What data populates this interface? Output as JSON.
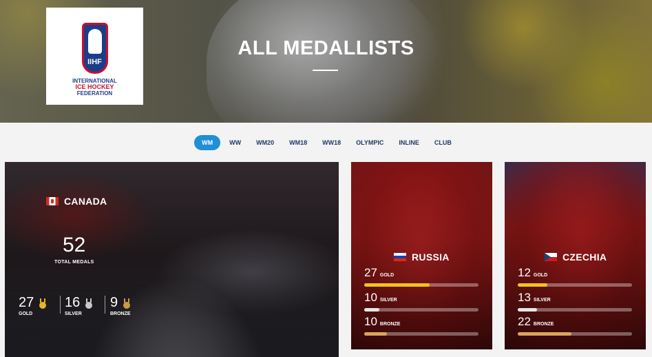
{
  "header": {
    "title": "ALL MEDALLISTS",
    "logo": {
      "abbr": "IIHF",
      "line1": "INTERNATIONAL",
      "line2": "ICE HOCKEY",
      "line3": "FEDERATION"
    }
  },
  "tabs": [
    {
      "label": "WM",
      "active": true
    },
    {
      "label": "WW",
      "active": false
    },
    {
      "label": "WM20",
      "active": false
    },
    {
      "label": "WM18",
      "active": false
    },
    {
      "label": "WW18",
      "active": false
    },
    {
      "label": "OLYMPIC",
      "active": false
    },
    {
      "label": "INLINE",
      "active": false
    },
    {
      "label": "CLUB",
      "active": false
    }
  ],
  "featured": {
    "country": "CANADA",
    "total": "52",
    "total_label": "TOTAL MEDALS",
    "gold": "27",
    "gold_label": "GOLD",
    "silver": "16",
    "silver_label": "SILVER",
    "bronze": "9",
    "bronze_label": "BRONZE"
  },
  "cards": [
    {
      "country": "RUSSIA",
      "gold": "27",
      "silver": "10",
      "bronze": "10",
      "gold_label": "GOLD",
      "silver_label": "SILVER",
      "bronze_label": "BRONZE",
      "gold_frac": 0.57,
      "silver_frac": 0.13,
      "bronze_frac": 0.2
    },
    {
      "country": "CZECHIA",
      "gold": "12",
      "silver": "13",
      "bronze": "22",
      "gold_label": "GOLD",
      "silver_label": "SILVER",
      "bronze_label": "BRONZE",
      "gold_frac": 0.26,
      "silver_frac": 0.17,
      "bronze_frac": 0.47
    }
  ],
  "colors": {
    "tab_active": "#1f8fd6",
    "gold": "#f0c419",
    "silver": "#e6e6e6",
    "bronze": "#d9a55a"
  }
}
